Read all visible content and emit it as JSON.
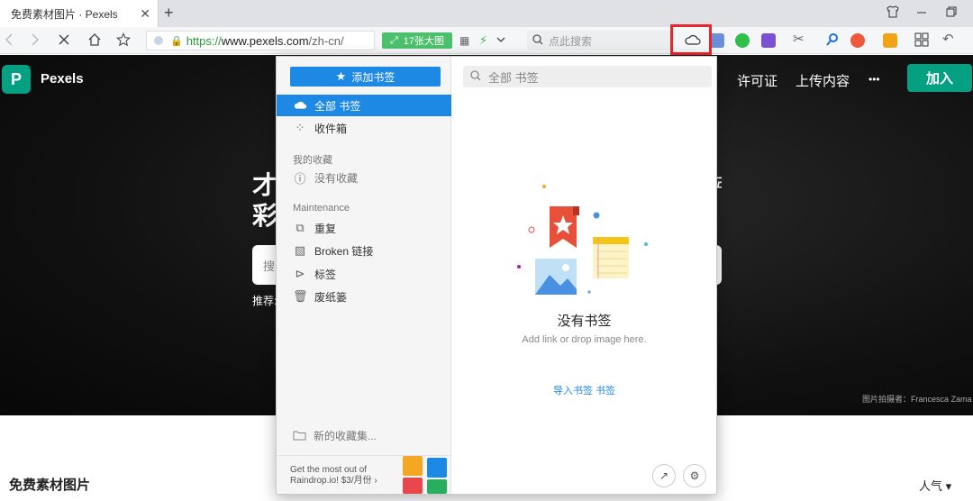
{
  "browser": {
    "tab_title": "免费素材图片 · Pexels",
    "tab_close": "✕",
    "new_tab": "+",
    "url_protocol": "https://",
    "url_host": "www.pexels.com",
    "url_path": "/zh-cn/",
    "image_badge": "17张大图",
    "search_placeholder": "点此搜索"
  },
  "site": {
    "logo_letter": "P",
    "logo_text": "Pexels",
    "nav_license": "许可证",
    "nav_upload": "上传内容",
    "nav_more": "•••",
    "join": "加入",
    "hero_title": "才 彩",
    "hero_search_placeholder": "搜",
    "hero_recommend": "推荐:",
    "hero_credit": "图片拍摄者：Francesca Zama",
    "section_title": "免费素材图片",
    "sort_label": "人气 ▾"
  },
  "raindrop": {
    "add_bookmark": "添加书签",
    "items": {
      "all": "全部 书签",
      "inbox": "收件箱",
      "my_collections": "我的收藏",
      "no_collections": "没有收藏",
      "maintenance": "Maintenance",
      "duplicates": "重复",
      "broken": "Broken 链接",
      "tags": "标签",
      "trash": "废纸篓"
    },
    "new_collection": "新的收藏集...",
    "promo": "Get the most out of Raindrop.io! $3/月份 ›",
    "search_placeholder": "全部 书签",
    "empty_title": "没有书签",
    "empty_subtitle": "Add link or drop image here.",
    "import_link": "导入书签 书签"
  },
  "colors": {
    "accent": "#1e88e5",
    "pexels_green": "#05a081",
    "highlight_red": "#e8262d"
  }
}
